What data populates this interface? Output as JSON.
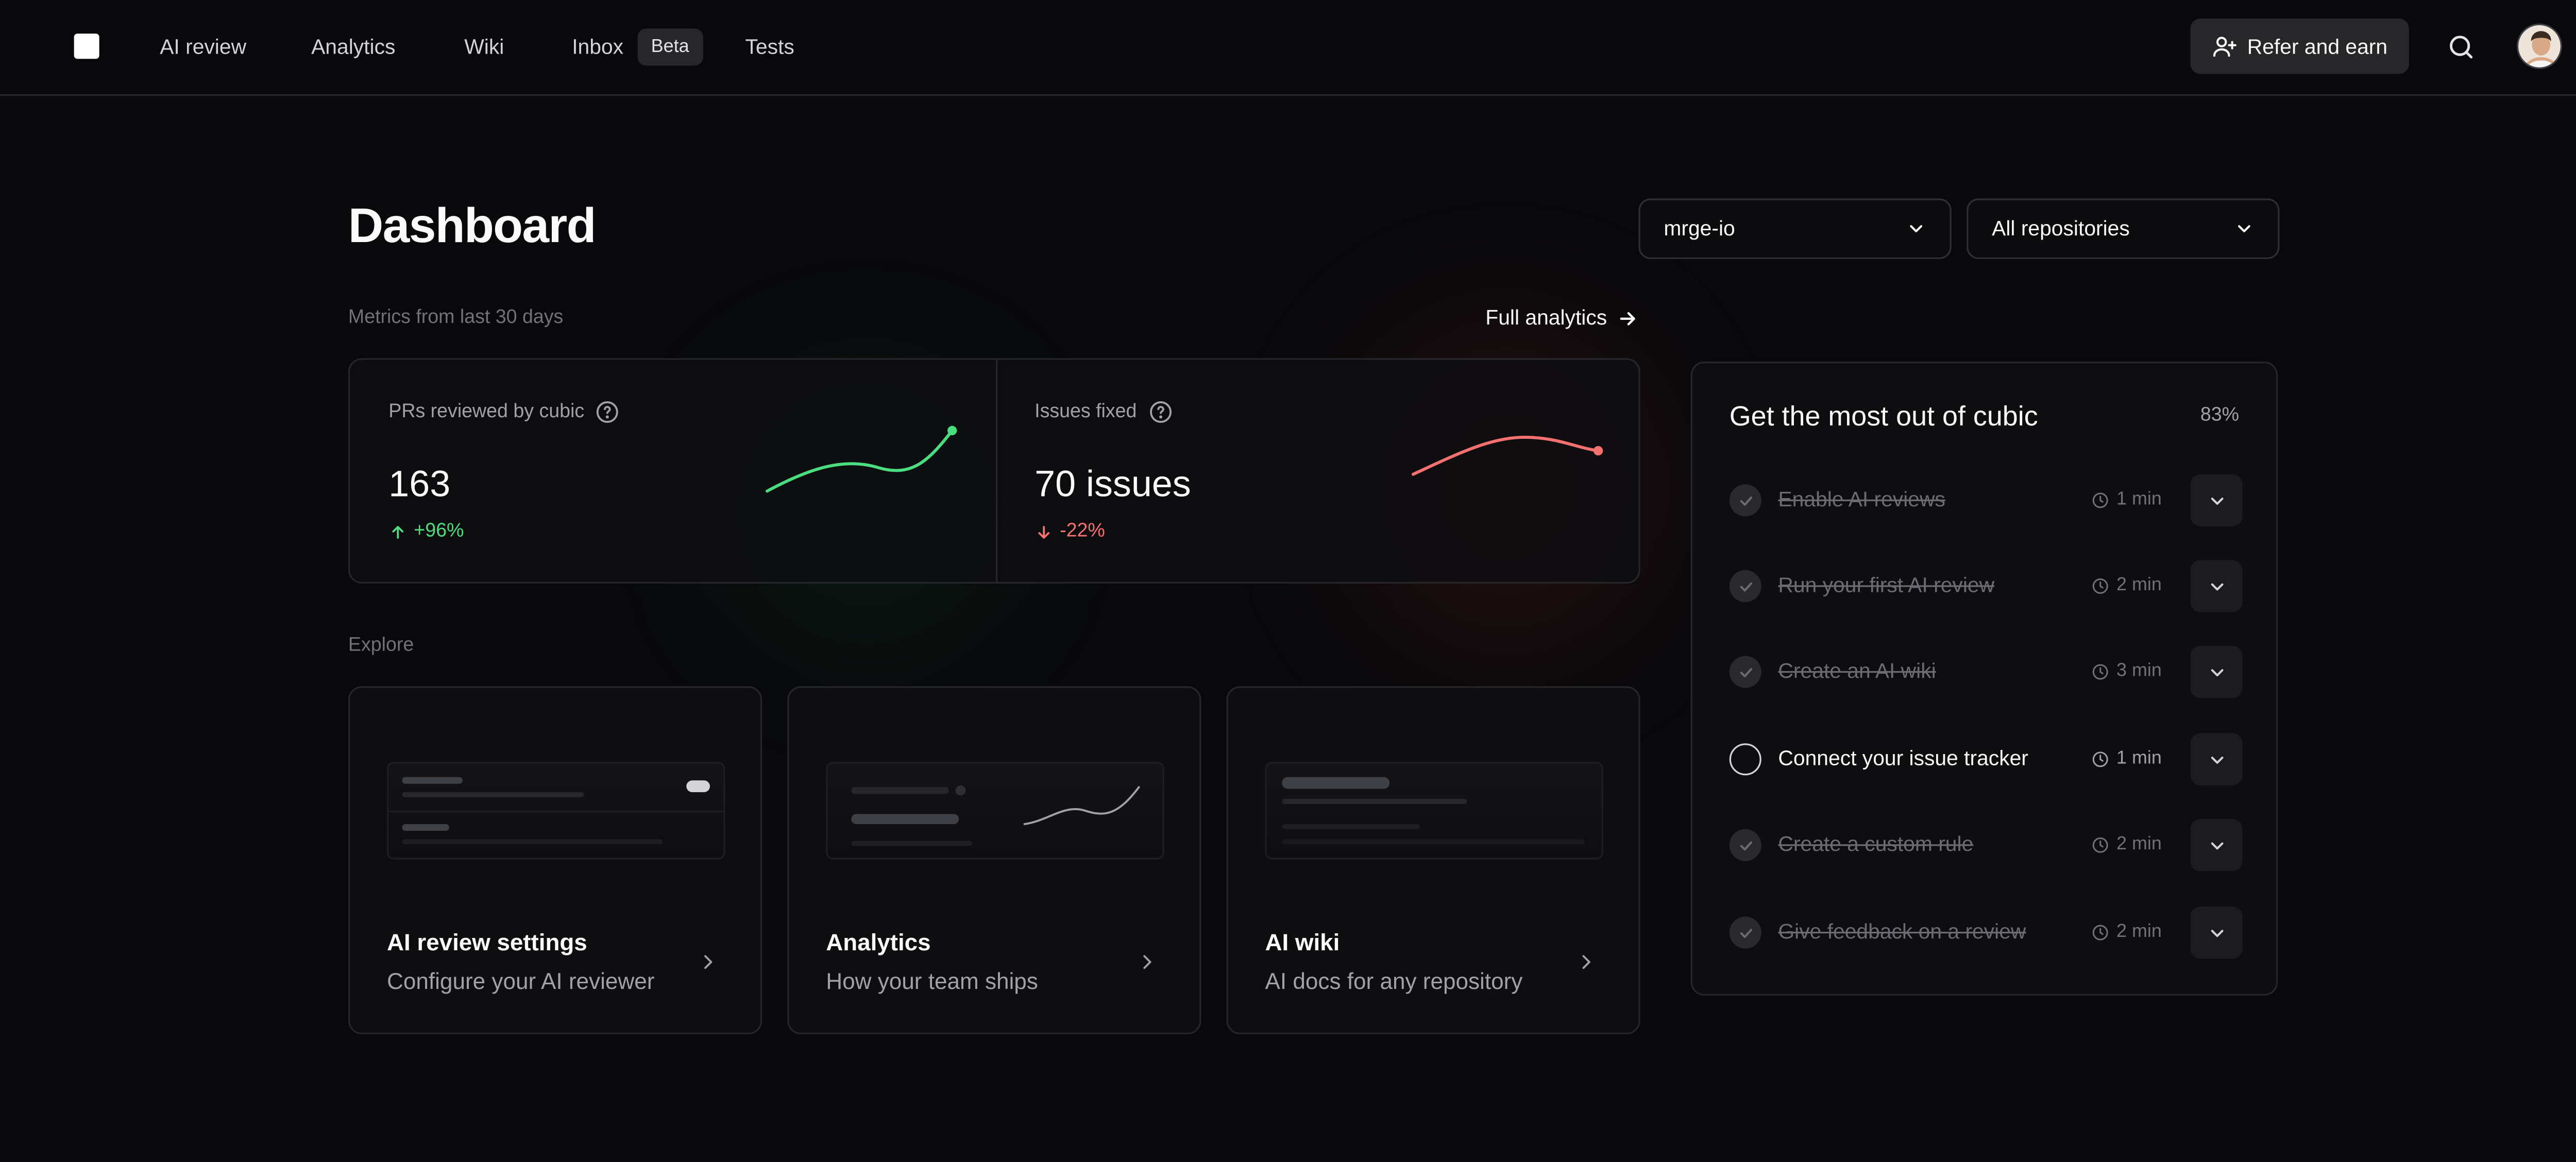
{
  "nav": {
    "items": [
      "AI review",
      "Analytics",
      "Wiki",
      "Inbox",
      "Tests"
    ],
    "beta_badge": "Beta",
    "refer_label": "Refer and earn",
    "icons": {
      "logo": "square-logo-icon",
      "refer": "user-plus-icon",
      "search": "search-icon"
    }
  },
  "header": {
    "title": "Dashboard",
    "org_select": "mrge-io",
    "repo_select": "All repositories"
  },
  "metrics": {
    "label": "Metrics from last 30 days",
    "full_analytics": "Full analytics",
    "items": [
      {
        "label": "PRs reviewed by cubic",
        "value": "163",
        "delta": "+96%",
        "trend": "up",
        "color": "#4ade80"
      },
      {
        "label": "Issues fixed",
        "value": "70 issues",
        "delta": "-22%",
        "trend": "down",
        "color": "#f87171"
      }
    ]
  },
  "explore": {
    "label": "Explore",
    "cards": [
      {
        "title": "AI review settings",
        "desc": "Configure your AI reviewer"
      },
      {
        "title": "Analytics",
        "desc": "How your team ships"
      },
      {
        "title": "AI wiki",
        "desc": "AI docs for any repository"
      }
    ]
  },
  "onboarding": {
    "title": "Get the most out of cubic",
    "progress": "83%",
    "tasks": [
      {
        "name": "Enable AI reviews",
        "time": "1 min",
        "done": true
      },
      {
        "name": "Run your first AI review",
        "time": "2 min",
        "done": true
      },
      {
        "name": "Create an AI wiki",
        "time": "3 min",
        "done": true
      },
      {
        "name": "Connect your issue tracker",
        "time": "1 min",
        "done": false
      },
      {
        "name": "Create a custom rule",
        "time": "2 min",
        "done": true
      },
      {
        "name": "Give feedback on a review",
        "time": "2 min",
        "done": true
      }
    ]
  },
  "colors": {
    "background": "#09090b",
    "positive": "#4ade80",
    "negative": "#f87171"
  }
}
